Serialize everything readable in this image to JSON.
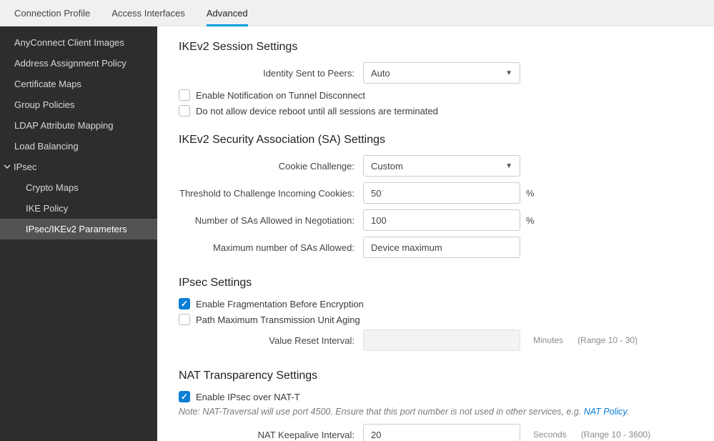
{
  "tabs": [
    {
      "label": "Connection Profile"
    },
    {
      "label": "Access Interfaces"
    },
    {
      "label": "Advanced"
    }
  ],
  "sidebar": {
    "items": [
      {
        "label": "AnyConnect Client Images"
      },
      {
        "label": "Address Assignment Policy"
      },
      {
        "label": "Certificate Maps"
      },
      {
        "label": "Group Policies"
      },
      {
        "label": "LDAP Attribute Mapping"
      },
      {
        "label": "Load Balancing"
      }
    ],
    "ipsec": {
      "label": "IPsec",
      "children": [
        {
          "label": "Crypto Maps"
        },
        {
          "label": "IKE Policy"
        },
        {
          "label": "IPsec/IKEv2 Parameters"
        }
      ]
    }
  },
  "main": {
    "ikev2_session": {
      "heading": "IKEv2 Session Settings",
      "identity_label": "Identity Sent to Peers:",
      "identity_value": "Auto",
      "notify_label": "Enable Notification on Tunnel Disconnect",
      "no_reboot_label": "Do not allow device reboot until all sessions are terminated"
    },
    "ikev2_sa": {
      "heading": "IKEv2 Security Association (SA) Settings",
      "cookie_label": "Cookie Challenge:",
      "cookie_value": "Custom",
      "threshold_label": "Threshold to Challenge Incoming Cookies:",
      "threshold_value": "50",
      "threshold_suffix": "%",
      "sa_neg_label": "Number of SAs Allowed in Negotiation:",
      "sa_neg_value": "100",
      "sa_neg_suffix": "%",
      "max_sa_label": "Maximum number of SAs Allowed:",
      "max_sa_value": "Device maximum"
    },
    "ipsec": {
      "heading": "IPsec Settings",
      "frag_label": "Enable Fragmentation Before Encryption",
      "pmtu_label": "Path Maximum Transmission Unit Aging",
      "reset_label": "Value Reset Interval:",
      "reset_unit": "Minutes",
      "reset_hint": "(Range 10 - 30)"
    },
    "nat": {
      "heading": "NAT Transparency Settings",
      "natt_label": "Enable IPsec over NAT-T",
      "note_prefix": "Note: NAT-Traversal will use port 4500. Ensure that this port number is not used in other services, e.g. ",
      "note_link": "NAT Policy",
      "note_suffix": ".",
      "keepalive_label": "NAT Keepalive Interval:",
      "keepalive_value": "20",
      "keepalive_unit": "Seconds",
      "keepalive_hint": "(Range 10 - 3600)"
    }
  }
}
